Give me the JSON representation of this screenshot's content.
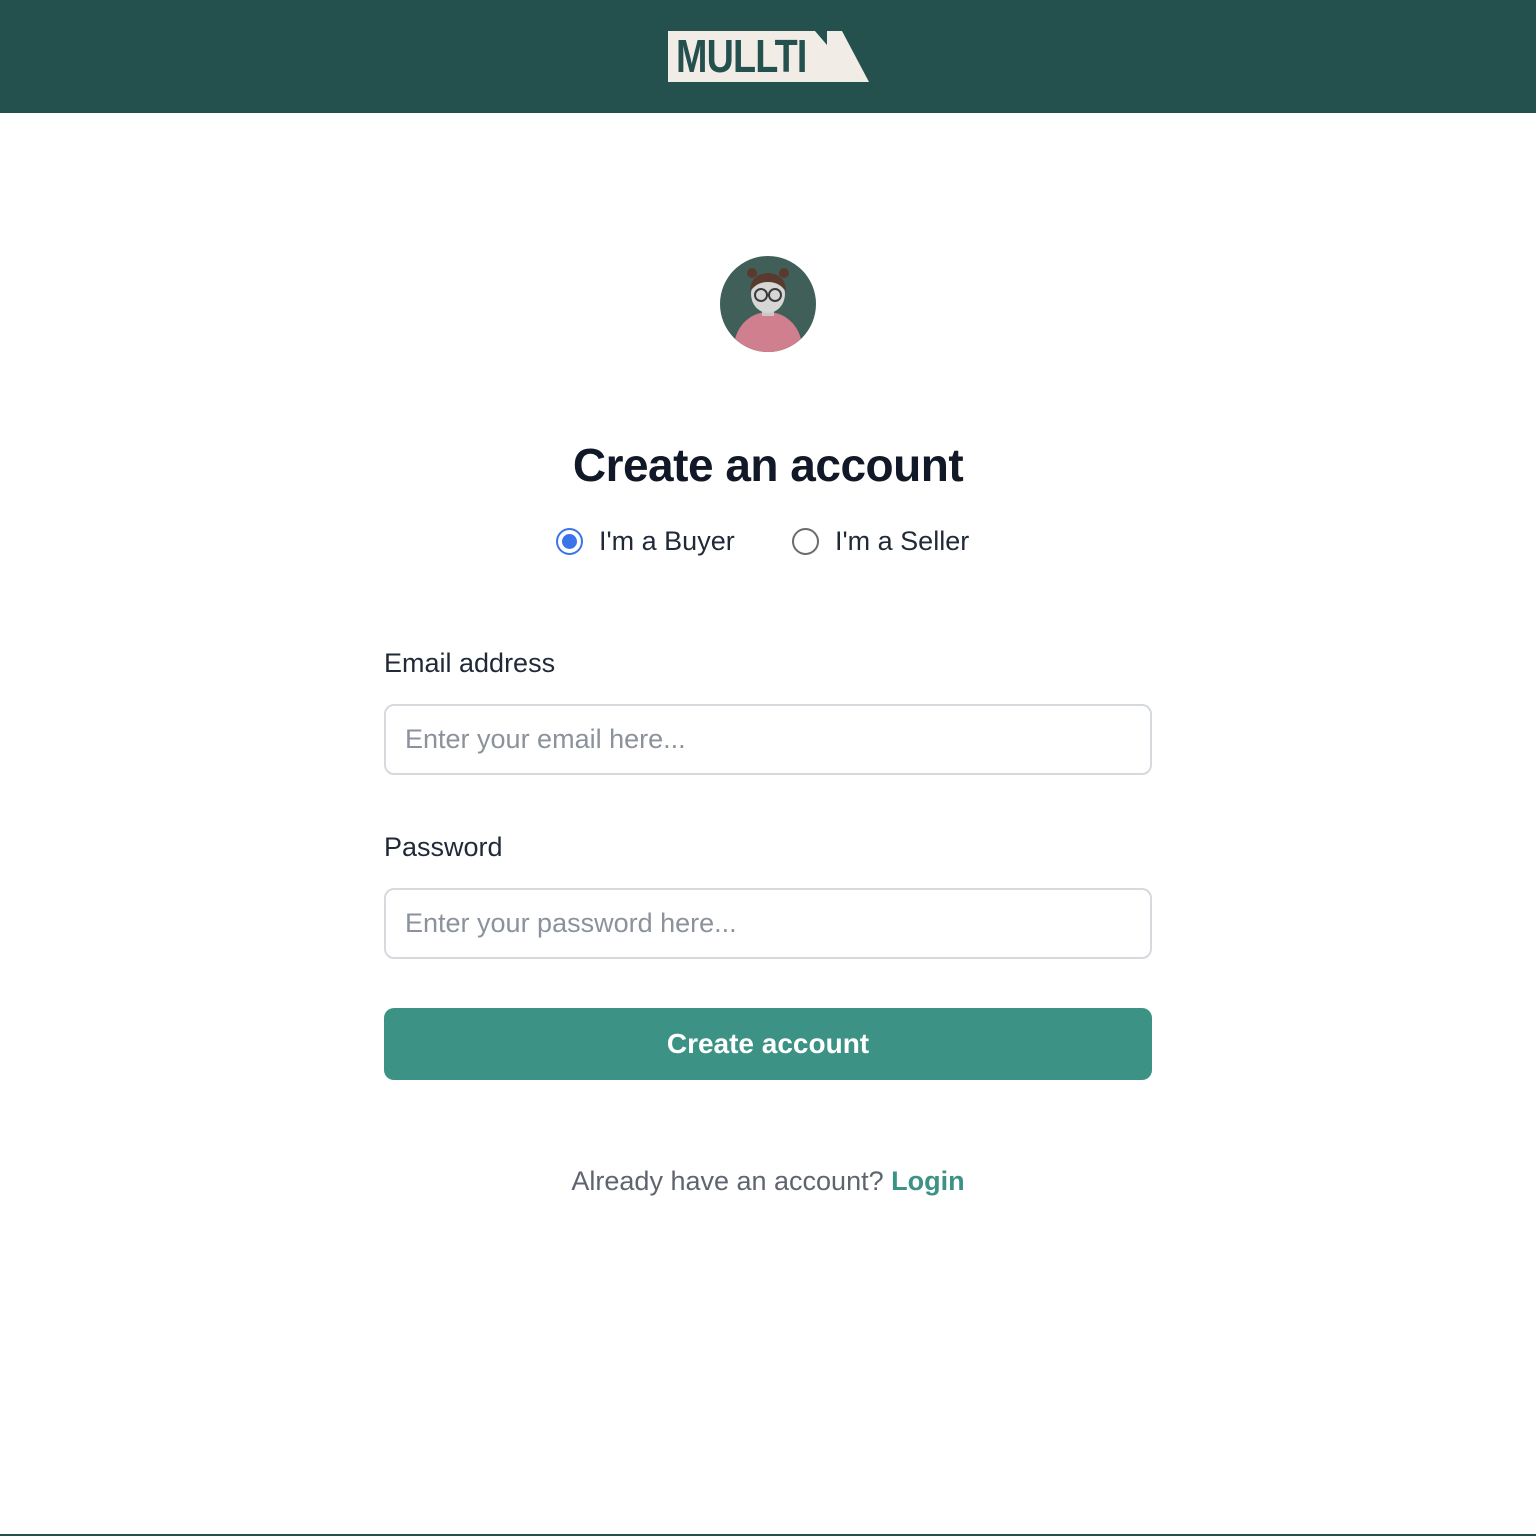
{
  "brand": {
    "logo_text": "MULLTI",
    "header_color": "#24504e",
    "accent_color": "#3c9385",
    "radio_color": "#3b74e8"
  },
  "avatar": {
    "icon": "user-avatar-illustration"
  },
  "form": {
    "title": "Create an account",
    "account_type": {
      "selected": "buyer",
      "options": [
        {
          "value": "buyer",
          "label": "I'm a Buyer",
          "checked": true
        },
        {
          "value": "seller",
          "label": "I'm a Seller",
          "checked": false
        }
      ]
    },
    "email": {
      "label": "Email address",
      "placeholder": "Enter your email here...",
      "value": ""
    },
    "password": {
      "label": "Password",
      "placeholder": "Enter your password here...",
      "value": ""
    },
    "submit_label": "Create account"
  },
  "footer": {
    "prompt": "Already have an account? ",
    "login_label": "Login"
  }
}
